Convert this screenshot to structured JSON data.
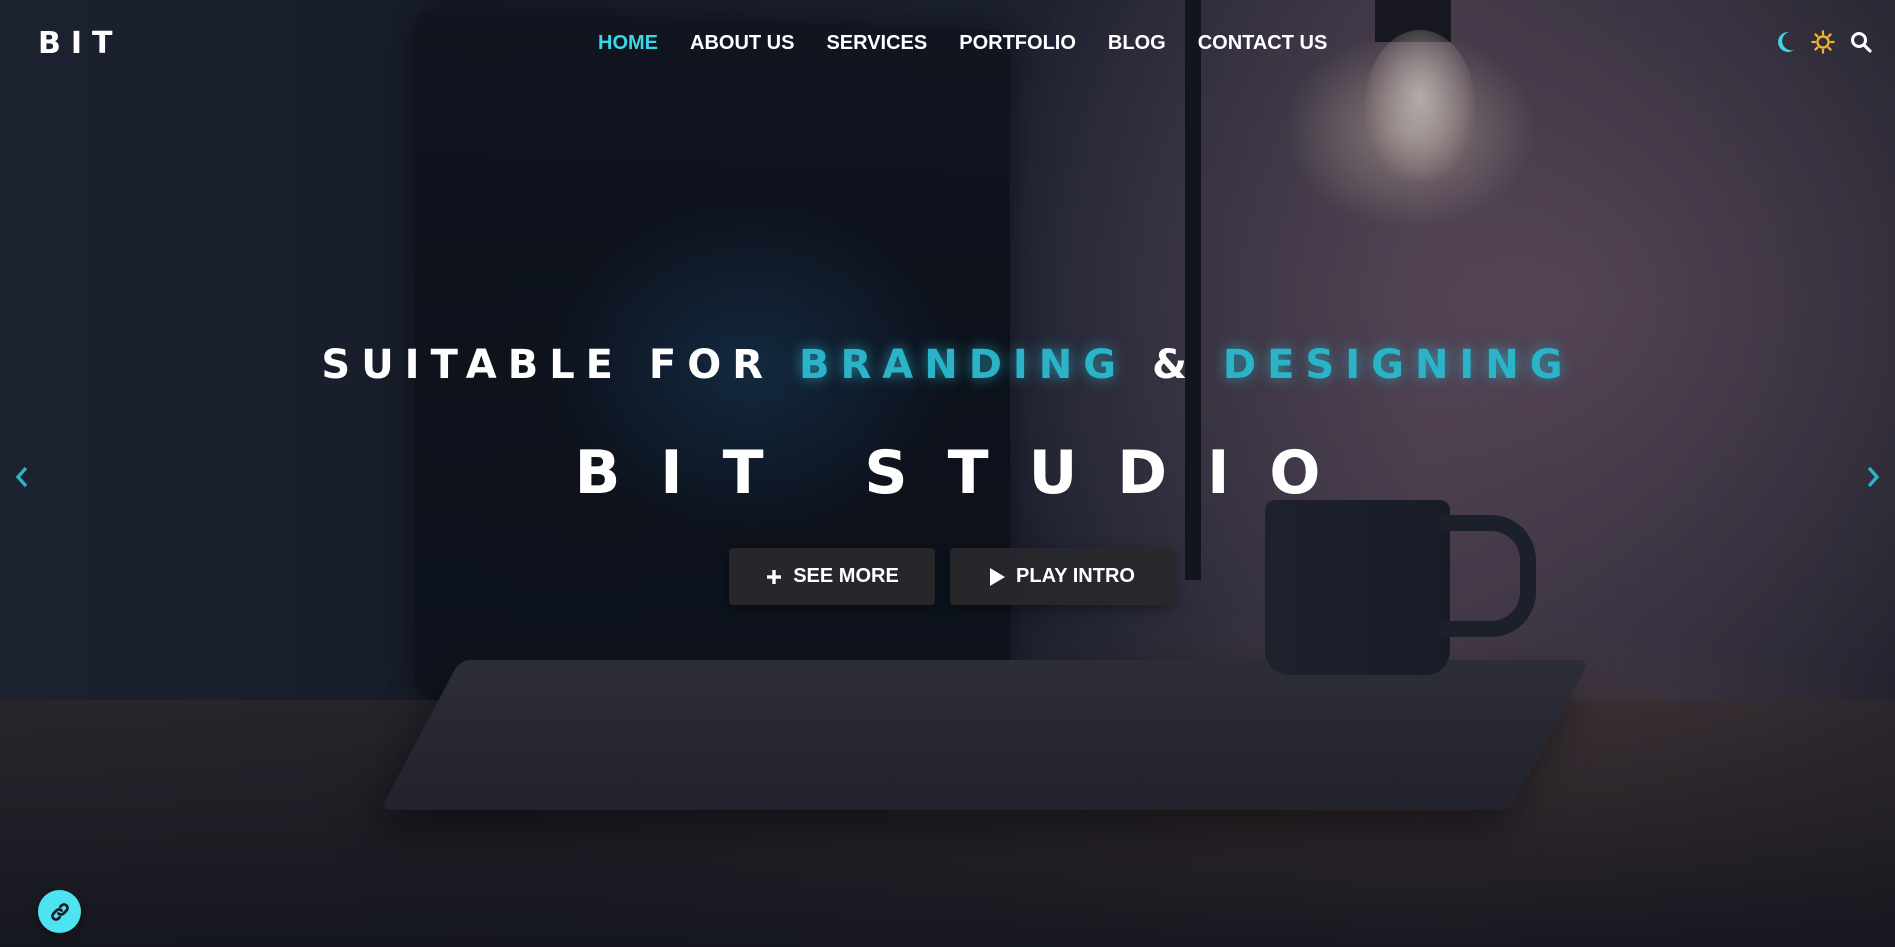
{
  "brand": {
    "logo": "BIT"
  },
  "nav": {
    "items": [
      {
        "label": "HOME",
        "active": true
      },
      {
        "label": "ABOUT US",
        "active": false
      },
      {
        "label": "SERVICES",
        "active": false
      },
      {
        "label": "PORTFOLIO",
        "active": false
      },
      {
        "label": "BLOG",
        "active": false
      },
      {
        "label": "CONTACT US",
        "active": false
      }
    ]
  },
  "header_icons": [
    "moon-icon",
    "sun-icon",
    "search-icon"
  ],
  "hero": {
    "tagline_prefix": "SUITABLE FOR",
    "tagline_accent_1": "BRANDING",
    "tagline_amp": "&",
    "tagline_accent_2": "DESIGNING",
    "title": "BIT STUDIO",
    "buttons": {
      "see_more": "SEE MORE",
      "play_intro": "PLAY INTRO"
    }
  },
  "carousel": {
    "prev_icon": "chevron-left-icon",
    "next_icon": "chevron-right-icon"
  },
  "floating": {
    "icon": "link-icon"
  },
  "colors": {
    "accent": "#3dd6e6",
    "tagline_accent": "#2bb3c8",
    "button_bg": "#28282c",
    "float_bg": "#4de3f0",
    "sun": "#f2b62e"
  }
}
